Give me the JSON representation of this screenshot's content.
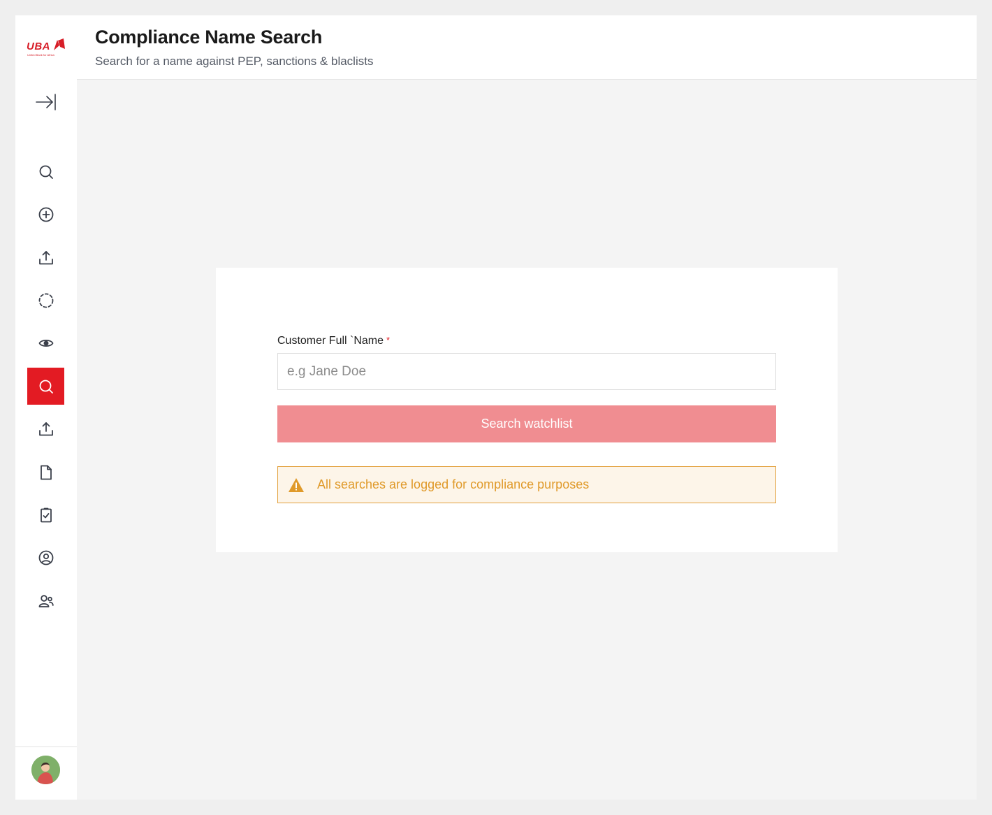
{
  "app": {
    "logo_text": "UBA",
    "logo_tagline": "United Bank for Africa",
    "brand_color": "#e31b23"
  },
  "header": {
    "title": "Compliance Name Search",
    "subtitle": "Search for a name against PEP, sanctions & blaclists"
  },
  "sidebar": {
    "collapse_icon": "collapse-right-icon",
    "items": [
      {
        "icon": "search-icon",
        "active": false
      },
      {
        "icon": "plus-circle-icon",
        "active": false
      },
      {
        "icon": "upload-icon",
        "active": false
      },
      {
        "icon": "dashed-circle-icon",
        "active": false
      },
      {
        "icon": "eye-icon",
        "active": false
      },
      {
        "icon": "search-icon",
        "active": true
      },
      {
        "icon": "upload-icon",
        "active": false
      },
      {
        "icon": "file-icon",
        "active": false
      },
      {
        "icon": "checklist-icon",
        "active": false
      },
      {
        "icon": "user-circle-icon",
        "active": false
      },
      {
        "icon": "users-icon",
        "active": false
      }
    ],
    "avatar_icon": "user-avatar"
  },
  "form": {
    "label": "Customer Full `Name",
    "required_mark": "*",
    "placeholder": "e.g Jane Doe",
    "value": "",
    "button_label": "Search watchlist",
    "button_color": "#f08d91"
  },
  "notice": {
    "icon": "warning-icon",
    "text": "All searches are logged for compliance purposes",
    "color": "#e09a2a"
  }
}
